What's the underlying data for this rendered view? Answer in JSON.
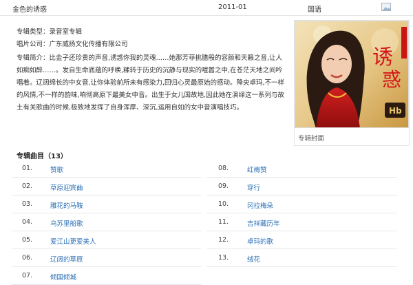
{
  "album_row": {
    "name": "金色的诱惑",
    "date": "2011-01",
    "language": "国语"
  },
  "info": {
    "type_label": "专辑类型：",
    "type_value": "录音室专辑",
    "company_label": "唱片公司：",
    "company_value": "广东威扬文化传播有限公司",
    "intro_label": "专辑简介：",
    "intro_text": "比金子还珍贵的声音,诱惑你我的灵魂……她那芳菲挑腊般的容颜和天籁之音,让人如痴如醉……。发自生命底蕴的呼唤,糅转于历史的沉静与现实的喧嚣之中,在苍茫天地之间吟唱着。辽阔绵长的中女音,让你体验前所未有感染力,回归心灵最原始的感动。降央卓玛,不一样的风情,不一样的韵味,响彻高原下最美女中音。出生于女儿国故地,因此她在演绎这一系列与故土有关歌曲的时候,极致地发挥了自身浑厚、深沉,运用自如的女中音演唱技巧。"
  },
  "cover": {
    "caption": "专辑封面"
  },
  "tracks_header": "专辑曲目（13）",
  "tracks_left": [
    {
      "num": "01.",
      "title": "赞歌"
    },
    {
      "num": "02.",
      "title": "草原迎宾曲"
    },
    {
      "num": "03.",
      "title": "雕花的马鞍"
    },
    {
      "num": "04.",
      "title": "乌苏里船歌"
    },
    {
      "num": "05.",
      "title": "爱江山更爱美人"
    },
    {
      "num": "06.",
      "title": "辽阔的草原"
    },
    {
      "num": "07.",
      "title": "倾国倾城"
    }
  ],
  "tracks_right": [
    {
      "num": "08.",
      "title": "红梅赞"
    },
    {
      "num": "09.",
      "title": "穿行"
    },
    {
      "num": "10.",
      "title": "冈拉梅朵"
    },
    {
      "num": "11.",
      "title": "吉祥藏历年"
    },
    {
      "num": "12.",
      "title": "卓玛的歌"
    },
    {
      "num": "13.",
      "title": "绒花"
    }
  ],
  "colors": {
    "link": "#2a6fb5",
    "divider": "#e8e8e8"
  }
}
